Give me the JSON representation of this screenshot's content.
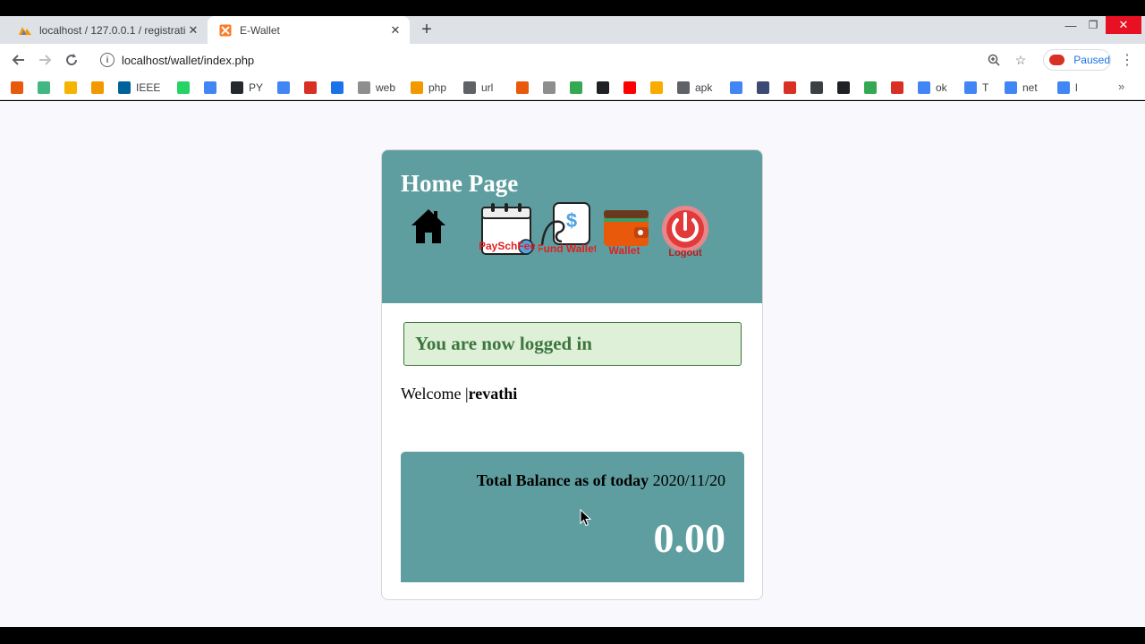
{
  "browser": {
    "tabs": [
      {
        "title": "localhost / 127.0.0.1 / registratio",
        "icon": "phpmyadmin-icon",
        "active": false
      },
      {
        "title": "E-Wallet",
        "icon": "xampp-icon",
        "active": true
      }
    ],
    "url": "localhost/wallet/index.php",
    "profile_label": "Paused",
    "bookmarks": [
      {
        "label": "",
        "icon": "arrow-icon",
        "color": "#e8590c"
      },
      {
        "label": "",
        "icon": "vue-icon",
        "color": "#41b883"
      },
      {
        "label": "",
        "icon": "box-icon",
        "color": "#f4b400"
      },
      {
        "label": "",
        "icon": "chart-icon",
        "color": "#f29900"
      },
      {
        "label": "IEEE",
        "icon": "ieee-icon",
        "color": "#00629b"
      },
      {
        "label": "",
        "icon": "whatsapp-icon",
        "color": "#25d366"
      },
      {
        "label": "",
        "icon": "stripes-icon",
        "color": "#4285f4"
      },
      {
        "label": "PY",
        "icon": "github-icon",
        "color": "#24292e"
      },
      {
        "label": "",
        "icon": "google-icon",
        "color": "#4285f4"
      },
      {
        "label": "",
        "icon": "gmail-icon",
        "color": "#d93025"
      },
      {
        "label": "",
        "icon": "drive-icon",
        "color": "#1a73e8"
      },
      {
        "label": "web",
        "icon": "shield-icon",
        "color": "#8e8e8e"
      },
      {
        "label": "php",
        "icon": "xampp-icon",
        "color": "#f29900"
      },
      {
        "label": "url",
        "icon": "lock-icon",
        "color": "#5f6368"
      },
      {
        "label": "",
        "icon": "fire-icon",
        "color": "#e8590c"
      },
      {
        "label": "",
        "icon": "flag-icon",
        "color": "#8e8e8e"
      },
      {
        "label": "",
        "icon": "ring-icon",
        "color": "#34a853"
      },
      {
        "label": "",
        "icon": "bolt-icon",
        "color": "#202124"
      },
      {
        "label": "",
        "icon": "youtube-icon",
        "color": "#ff0000"
      },
      {
        "label": "",
        "icon": "p-icon",
        "color": "#f9ab00"
      },
      {
        "label": "apk",
        "icon": "envelope-icon",
        "color": "#5f6368"
      },
      {
        "label": "",
        "icon": "google-icon",
        "color": "#4285f4"
      },
      {
        "label": "",
        "icon": "gear-icon",
        "color": "#3c4a74"
      },
      {
        "label": "",
        "icon": "tl-icon",
        "color": "#d93025"
      },
      {
        "label": "",
        "icon": "globe-icon",
        "color": "#3c4043"
      },
      {
        "label": "",
        "icon": "cl-icon",
        "color": "#202124"
      },
      {
        "label": "",
        "icon": "circle-icon",
        "color": "#34a853"
      },
      {
        "label": "",
        "icon": "y-icon",
        "color": "#d93025"
      },
      {
        "label": "ok",
        "icon": "google-icon",
        "color": "#4285f4"
      },
      {
        "label": "T",
        "icon": "google-icon",
        "color": "#4285f4"
      },
      {
        "label": "net",
        "icon": "google-icon",
        "color": "#4285f4"
      },
      {
        "label": "l",
        "icon": "google-icon",
        "color": "#4285f4"
      },
      {
        "label": "",
        "icon": "google-icon",
        "color": "#4285f4"
      }
    ]
  },
  "page": {
    "title": "Home Page",
    "nav": [
      {
        "name": "home",
        "label": "",
        "icon": "home-icon"
      },
      {
        "name": "payschfee",
        "label": "PaySchFee",
        "icon": "calendar-icon"
      },
      {
        "name": "fund-wallet",
        "label": "Fund Wallet",
        "icon": "money-hand-icon"
      },
      {
        "name": "wallet",
        "label": "Wallet",
        "icon": "wallet-icon"
      },
      {
        "name": "logout",
        "label": "Logout",
        "icon": "power-icon"
      }
    ],
    "alert": "You are now logged in",
    "welcome_prefix": "Welcome |",
    "username": "revathi",
    "balance": {
      "label": "Total Balance as of today",
      "date": "2020/11/20",
      "amount": "0.00"
    },
    "colors": {
      "header": "#5f9ea0",
      "alert_bg": "#dff0d8",
      "alert_text": "#3c763d"
    }
  }
}
